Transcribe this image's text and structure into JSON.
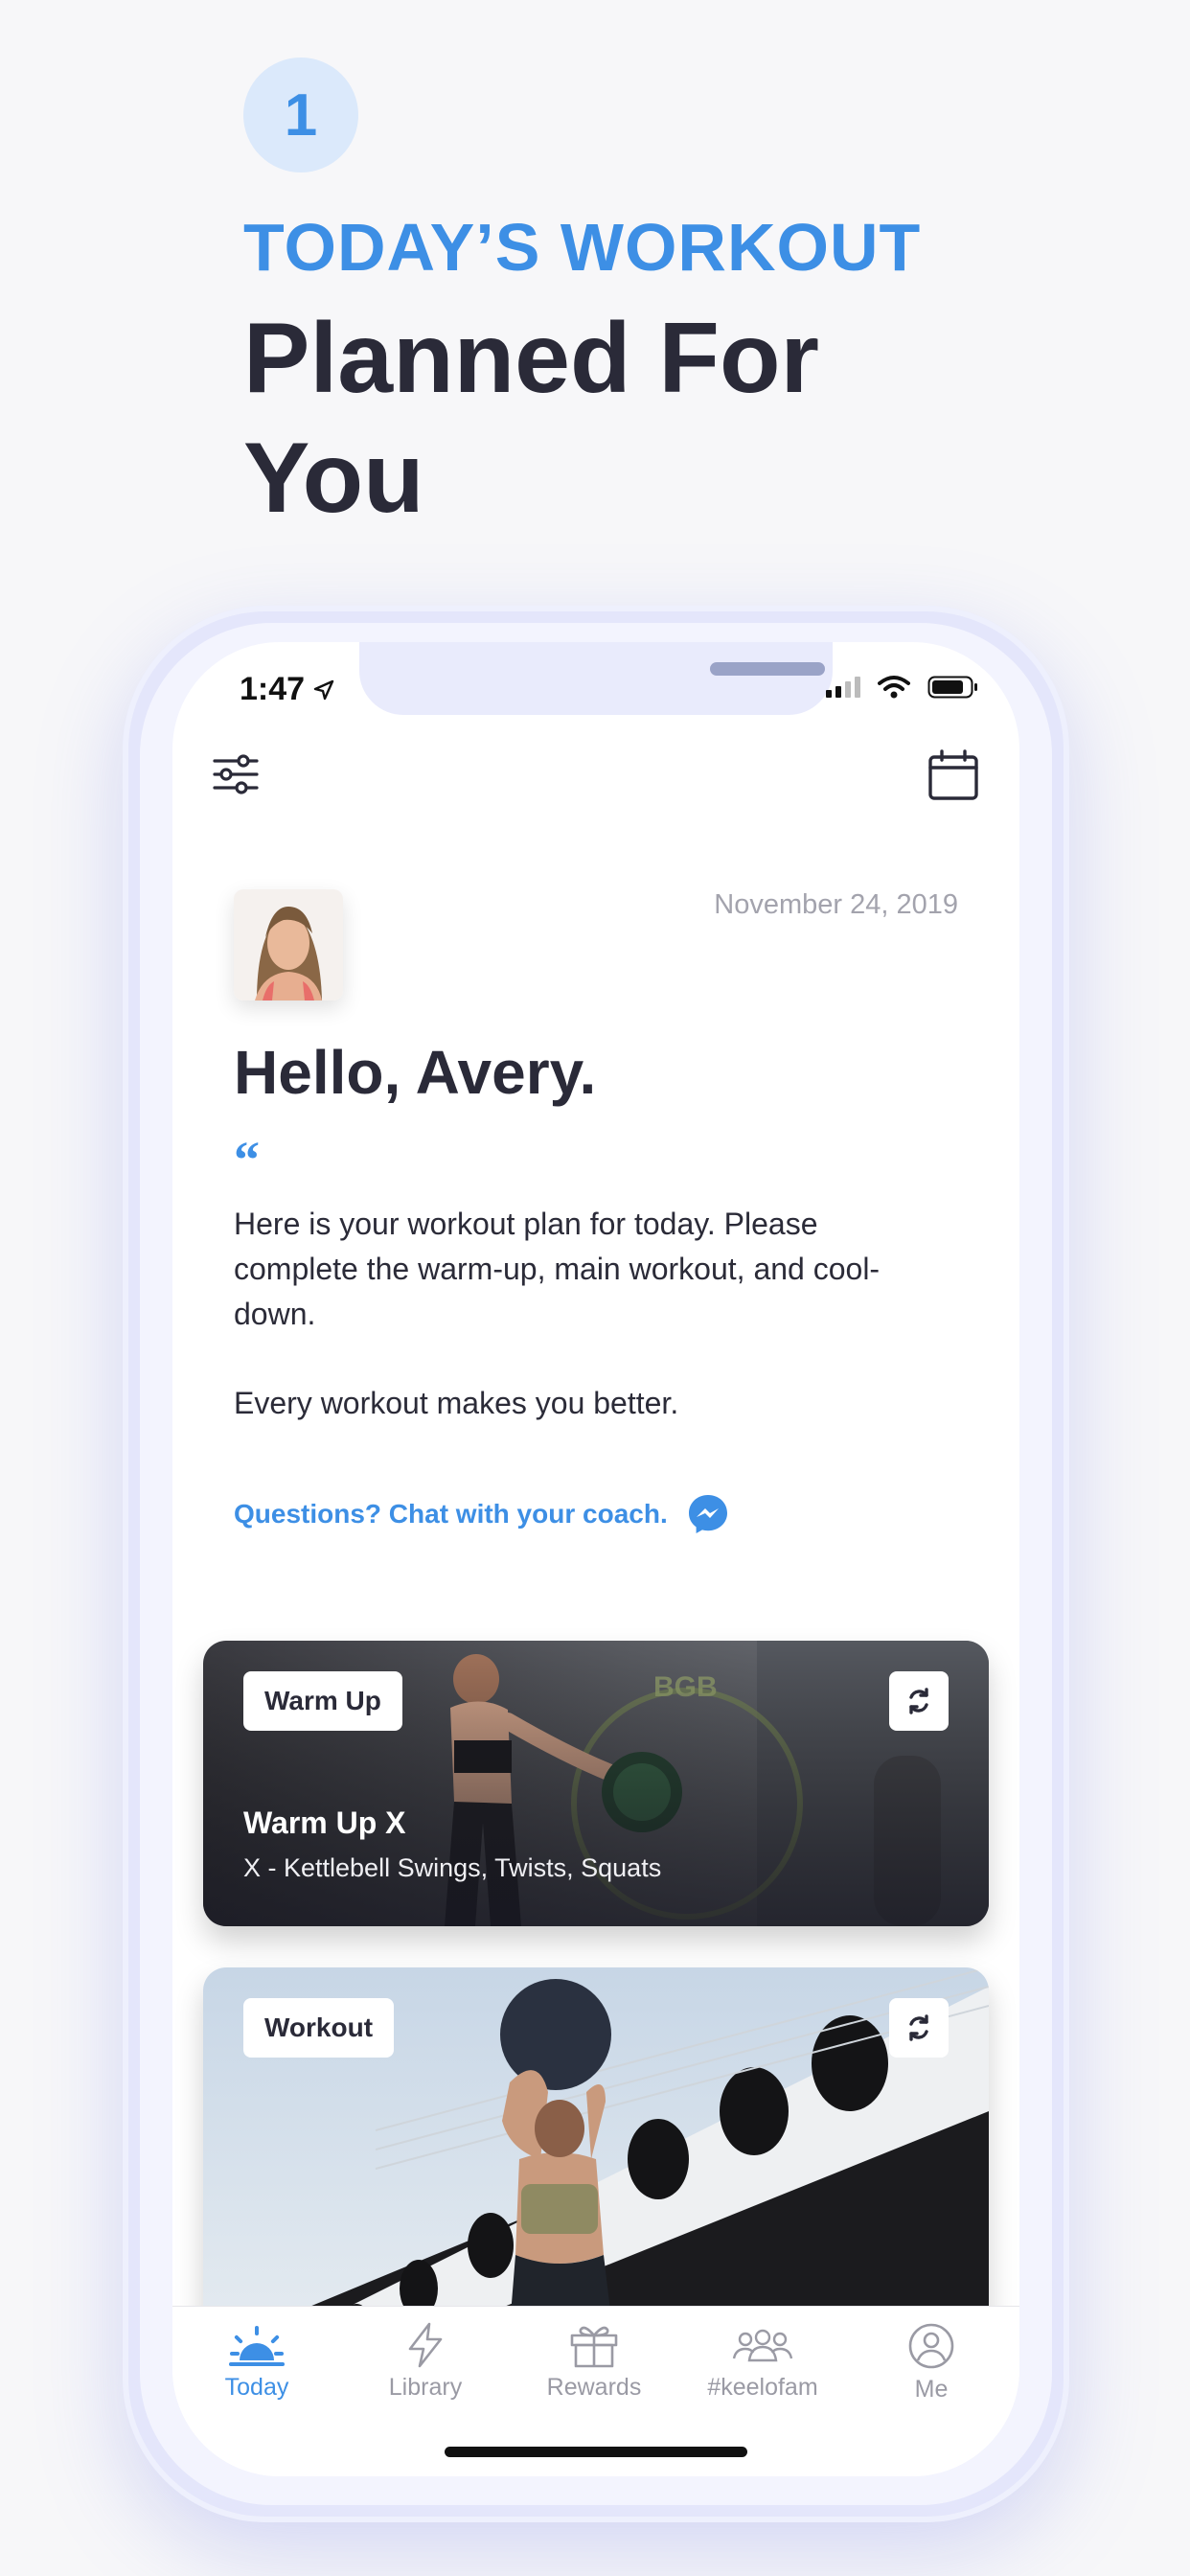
{
  "marketing": {
    "step_number": "1",
    "eyebrow": "TODAY’S WORKOUT",
    "headline": "Planned For You"
  },
  "status_bar": {
    "time": "1:47"
  },
  "header": {
    "filter_icon": "sliders-icon",
    "calendar_icon": "calendar-icon"
  },
  "greeting_section": {
    "date": "November 24, 2019",
    "greeting": "Hello, Avery.",
    "quote_mark": "“",
    "message_paragraphs": [
      "Here is your workout plan for today.  Please complete the warm-up, main workout, and cool-down.",
      "Every workout makes you better."
    ],
    "coach_link": "Questions? Chat with your coach."
  },
  "cards": [
    {
      "tag": "Warm Up",
      "title": "Warm Up X",
      "subtitle": "X - Kettlebell Swings, Twists, Squats"
    },
    {
      "tag": "Workout"
    }
  ],
  "tabs": [
    {
      "label": "Today",
      "icon": "sunrise-icon",
      "active": true
    },
    {
      "label": "Library",
      "icon": "bolt-icon",
      "active": false
    },
    {
      "label": "Rewards",
      "icon": "gift-icon",
      "active": false
    },
    {
      "label": "#keelofam",
      "icon": "group-icon",
      "active": false
    },
    {
      "label": "Me",
      "icon": "profile-icon",
      "active": false
    }
  ],
  "colors": {
    "accent": "#3d8fe5",
    "text_dark": "#2a2a38",
    "muted": "#9a9aa4"
  }
}
